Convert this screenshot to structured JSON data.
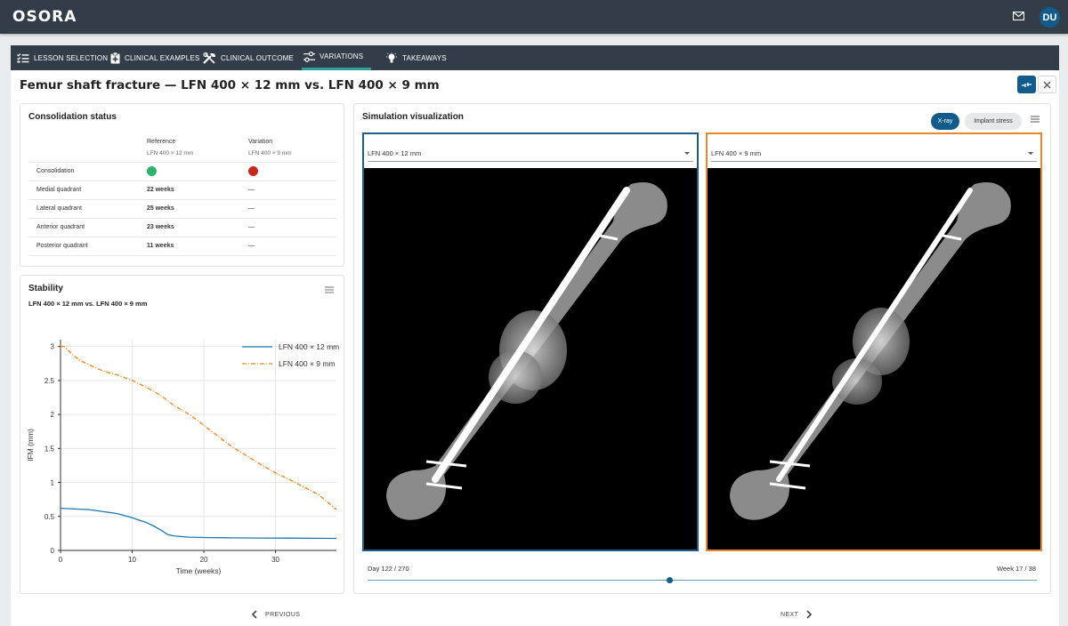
{
  "app": {
    "logo": "OSORA",
    "avatar_initials": "DU",
    "mail_icon": "mail-icon"
  },
  "tabs": [
    {
      "label": "LESSON SELECTION",
      "icon": "checklist-icon",
      "active": false
    },
    {
      "label": "CLINICAL EXAMPLES",
      "icon": "clipboard-icon",
      "active": false
    },
    {
      "label": "CLINICAL OUTCOME",
      "icon": "tools-icon",
      "active": false
    },
    {
      "label": "VARIATIONS",
      "icon": "sliders-icon",
      "active": true
    },
    {
      "label": "TAKEAWAYS",
      "icon": "lightbulb-icon",
      "active": false
    }
  ],
  "page": {
    "title": "Femur shaft fracture — LFN 400 × 12 mm vs. LFN 400 × 9 mm"
  },
  "consolidation": {
    "title": "Consolidation status",
    "headers": [
      {
        "title": "Reference",
        "sub": "LFN 400 × 12 mm"
      },
      {
        "title": "Variation",
        "sub": "LFN 400 × 9 mm"
      }
    ],
    "rows": [
      {
        "label": "Consolidation",
        "reference": "",
        "variation": ""
      },
      {
        "label": "Medial quadrant",
        "reference": "22 weeks",
        "variation": "—"
      },
      {
        "label": "Lateral quadrant",
        "reference": "25 weeks",
        "variation": "—"
      },
      {
        "label": "Anterior quadrant",
        "reference": "23 weeks",
        "variation": "—"
      },
      {
        "label": "Posterior quadrant",
        "reference": "11 weeks",
        "variation": "—"
      }
    ],
    "status_colors": {
      "reference": "#2db36b",
      "variation": "#c8281e"
    }
  },
  "stability": {
    "title": "Stability",
    "subtitle": "LFN 400 × 12 mm vs. LFN 400 × 9 mm"
  },
  "chart_data": {
    "type": "line",
    "xlabel": "Time (weeks)",
    "ylabel": "IFM (mm)",
    "xlim": [
      0,
      38.5
    ],
    "ylim": [
      0,
      3.1
    ],
    "xticks": [
      0,
      10,
      20,
      30
    ],
    "yticks": [
      0,
      0.5,
      1,
      1.5,
      2,
      2.5,
      3
    ],
    "ytick_labels": [
      "0",
      "0.5",
      "1",
      "1.5",
      "2",
      "2.5",
      "3"
    ],
    "grid": true,
    "legend": "top-right",
    "series": [
      {
        "name": "LFN 400 × 12 mm",
        "color": "#1f77b4",
        "style": "solid",
        "x": [
          0,
          2,
          4,
          6,
          8,
          10,
          12,
          13,
          14,
          15,
          16,
          18,
          20,
          24,
          28,
          32,
          36,
          38.5
        ],
        "y": [
          0.62,
          0.61,
          0.6,
          0.57,
          0.54,
          0.48,
          0.41,
          0.36,
          0.3,
          0.23,
          0.21,
          0.195,
          0.19,
          0.185,
          0.182,
          0.18,
          0.178,
          0.177
        ]
      },
      {
        "name": "LFN 400 × 9 mm",
        "color": "#ff7f0e",
        "style": "dashdot",
        "x": [
          0,
          0.5,
          1,
          2,
          3,
          4,
          5,
          6,
          8,
          10,
          12,
          14,
          16,
          18,
          20,
          22,
          24,
          26,
          28,
          30,
          32,
          34,
          36,
          38.5
        ],
        "y": [
          3.0,
          3.0,
          2.95,
          2.85,
          2.78,
          2.73,
          2.68,
          2.64,
          2.58,
          2.5,
          2.4,
          2.28,
          2.12,
          2.0,
          1.84,
          1.68,
          1.52,
          1.39,
          1.26,
          1.14,
          1.04,
          0.93,
          0.82,
          0.6
        ]
      }
    ]
  },
  "simulation": {
    "title": "Simulation visualization",
    "mode_buttons": [
      "X-ray",
      "Implant stress"
    ],
    "viewers": [
      {
        "select": "LFN 400 × 12 mm",
        "accent": "#1f5d8c"
      },
      {
        "select": "LFN 400 × 9 mm",
        "accent": "#e8872c"
      }
    ],
    "day_label": "Day 122 / 270",
    "week_label": "Week 17 / 38",
    "timeline_progress": 0.452
  },
  "nav": {
    "previous": "PREVIOUS",
    "next": "NEXT"
  }
}
